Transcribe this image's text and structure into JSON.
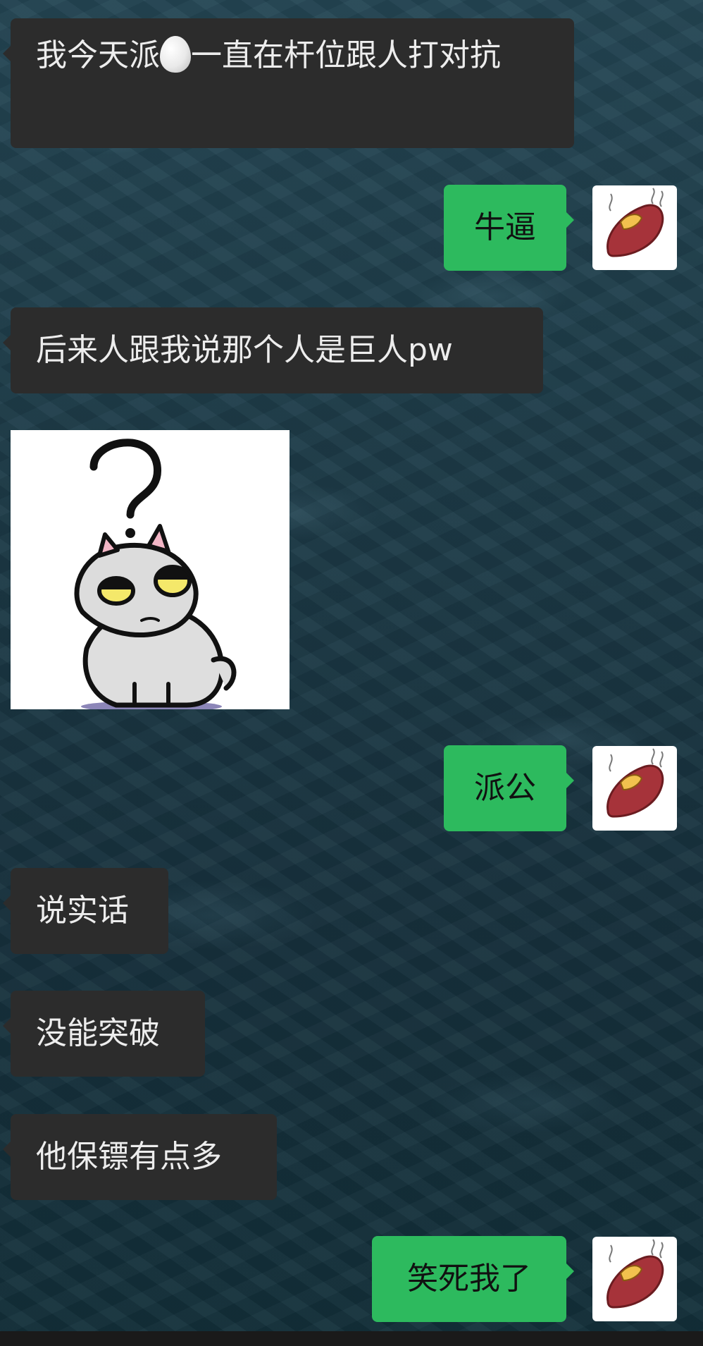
{
  "chat": {
    "messages": [
      {
        "id": 1,
        "side": "in",
        "type": "text",
        "text_before": "我今天派",
        "emoji": "egg-emoji",
        "text_after": "一直在杆位跟人打对抗"
      },
      {
        "id": 2,
        "side": "out",
        "type": "text",
        "text": "牛逼"
      },
      {
        "id": 3,
        "side": "in",
        "type": "text",
        "text": "后来人跟我说那个人是巨人pw"
      },
      {
        "id": 4,
        "side": "in",
        "type": "sticker",
        "sticker": "confused-cat-question-mark"
      },
      {
        "id": 5,
        "side": "out",
        "type": "text",
        "text": "派公"
      },
      {
        "id": 6,
        "side": "in",
        "type": "text",
        "text": "说实话"
      },
      {
        "id": 7,
        "side": "in",
        "type": "text",
        "text": "没能突破"
      },
      {
        "id": 8,
        "side": "in",
        "type": "text",
        "text": "他保镖有点多"
      },
      {
        "id": 9,
        "side": "out",
        "type": "text",
        "text": "笑死我了"
      }
    ],
    "self_avatar": "roasted-sweet-potato-avatar"
  },
  "colors": {
    "incoming_bubble": "#2c2c2c",
    "outgoing_bubble": "#2dba5e",
    "incoming_text": "#ededed",
    "outgoing_text": "#111111",
    "background": "#1c3a47"
  }
}
